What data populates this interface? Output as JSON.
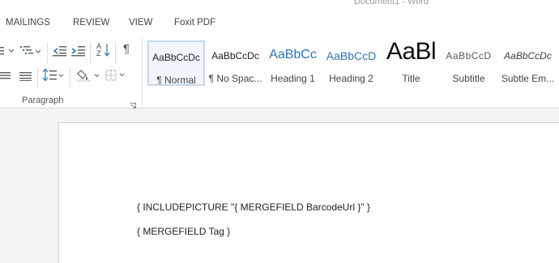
{
  "window": {
    "title": "Document1 - Word"
  },
  "ribbon_tabs": [
    {
      "label": "MAILINGS"
    },
    {
      "label": "REVIEW"
    },
    {
      "label": "VIEW"
    },
    {
      "label": "Foxit PDF"
    }
  ],
  "paragraph_group": {
    "label": "Paragraph",
    "sort_glyph": "A Z",
    "pilcrow_glyph": "¶"
  },
  "styles": [
    {
      "preview": "AaBbCcDc",
      "label": "¶ Normal",
      "selected": true
    },
    {
      "preview": "AaBbCcDc",
      "label": "¶ No Spac..."
    },
    {
      "preview": "AaBbCc",
      "label": "Heading 1"
    },
    {
      "preview": "AaBbCcD",
      "label": "Heading 2"
    },
    {
      "preview": "AaBl",
      "label": "Title"
    },
    {
      "preview": "AaBbCcD",
      "label": "Subtitle"
    },
    {
      "preview": "AaBbCcDc",
      "label": "Subtle Em..."
    }
  ],
  "colors": {
    "heading_blue": "#2e74b5",
    "subtitle_gray": "#595959",
    "selected_border": "#c5d7ea"
  },
  "document": {
    "lines": [
      "{ INCLUDEPICTURE \"{ MERGEFIELD BarcodeUrl }\" }",
      "{ MERGEFIELD Tag }"
    ]
  }
}
